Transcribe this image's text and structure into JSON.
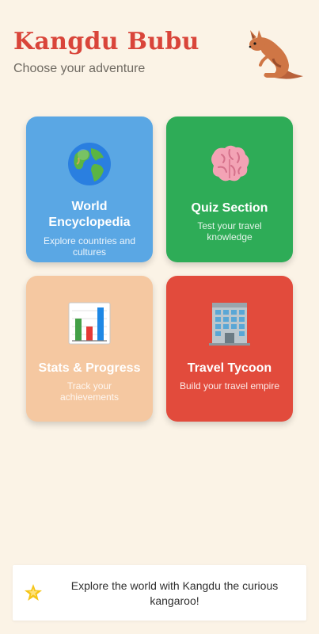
{
  "header": {
    "title": "Kangdu Bubu",
    "subtitle": "Choose your adventure",
    "mascot_icon": "kangaroo-icon"
  },
  "cards": [
    {
      "title": "World Encyclopedia",
      "description": "Explore countries and cultures",
      "icon": "globe-icon",
      "color": "#5aa7e4"
    },
    {
      "title": "Quiz Section",
      "description": "Test your travel knowledge",
      "icon": "brain-icon",
      "color": "#2eac57"
    },
    {
      "title": "Stats & Progress",
      "description": "Track your achievements",
      "icon": "bar-chart-icon",
      "color": "#f5c8a1"
    },
    {
      "title": "Travel Tycoon",
      "description": "Build your travel empire",
      "icon": "office-building-icon",
      "color": "#e24b3c"
    }
  ],
  "footer": {
    "icon": "star-icon",
    "text": "Explore the world with Kangdu the curious kangaroo!"
  }
}
